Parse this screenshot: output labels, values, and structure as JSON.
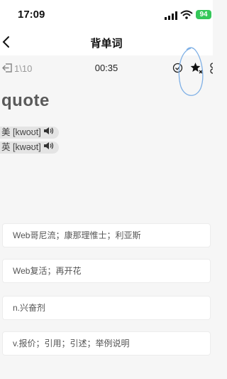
{
  "status_bar": {
    "time": "17:09",
    "battery": "94"
  },
  "nav": {
    "title": "背单词"
  },
  "toolbar": {
    "progress": "1\\10",
    "timer": "00:35"
  },
  "word": {
    "text": "quote",
    "phonetics": [
      {
        "label": "美 [kwoʊt]"
      },
      {
        "label": "英 [kwəʊt]"
      }
    ]
  },
  "options": [
    "Web哥尼流；康那理惟士；利亚斯",
    "Web复活；再开花",
    "n.兴奋剂",
    "v.报价；引用；引述；举例说明"
  ],
  "colors": {
    "accent_battery": "#34c759",
    "annotation_stroke": "#7fb0e6"
  }
}
